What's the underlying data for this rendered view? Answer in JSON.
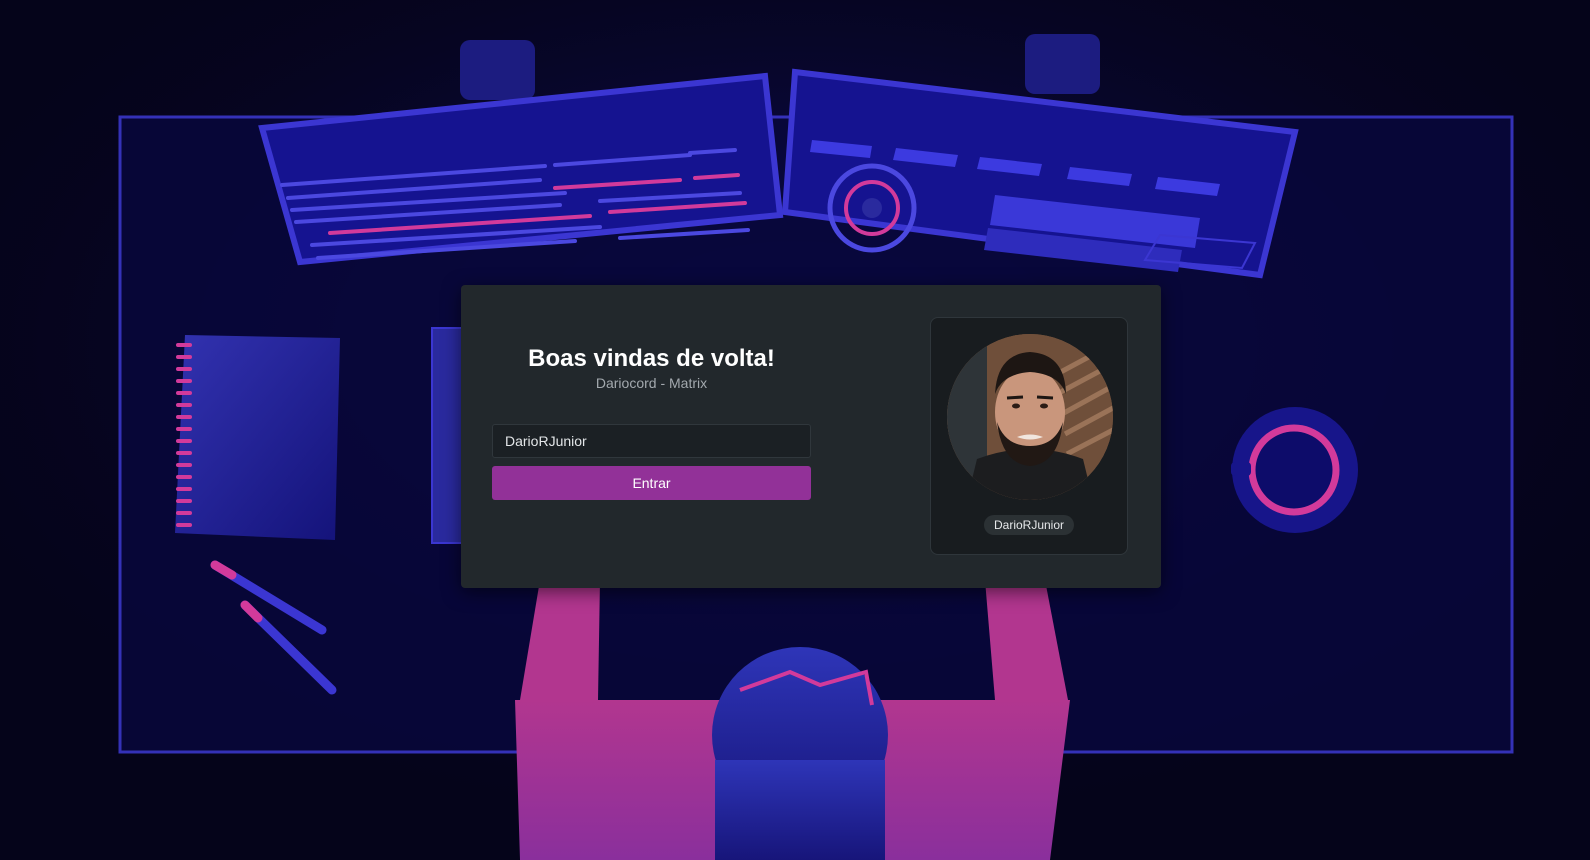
{
  "login": {
    "title": "Boas vindas de volta!",
    "subtitle": "Dariocord - Matrix",
    "username_value": "DarioRJunior",
    "submit_label": "Entrar"
  },
  "profile": {
    "username": "DarioRJunior"
  },
  "colors": {
    "background": "#05041a",
    "card": "#22282c",
    "accent": "#923198",
    "illustration_blue": "#2a2a9e",
    "illustration_pink": "#d23a9b"
  }
}
